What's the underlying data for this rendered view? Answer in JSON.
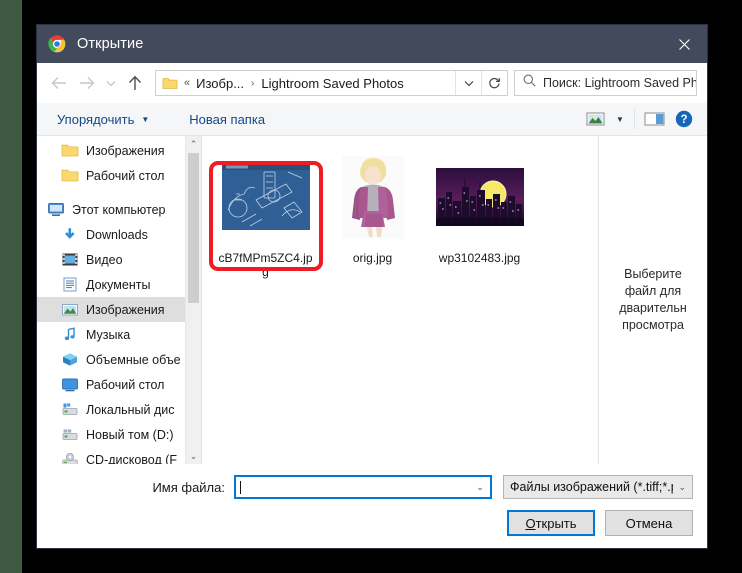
{
  "window": {
    "title": "Открытие",
    "app_icon": "chrome-icon",
    "close_label": "✕"
  },
  "nav": {
    "back_icon": "arrow-left-icon",
    "forward_icon": "arrow-right-icon",
    "recent_icon": "chevron-down-icon",
    "up_icon": "arrow-up-icon",
    "breadcrumb": {
      "folder_icon": "folder-icon",
      "overflow": "«",
      "items": [
        "Изобр...",
        "Lightroom Saved Photos"
      ],
      "separator": "›"
    },
    "dropdown_icon": "chevron-down-icon",
    "refresh_icon": "refresh-icon",
    "search": {
      "icon": "search-icon",
      "placeholder": "Поиск: Lightroom Saved Ph..."
    }
  },
  "toolbar": {
    "organize_label": "Упорядочить",
    "organize_caret": "▼",
    "new_folder_label": "Новая папка",
    "view_icon": "view-layout-icon",
    "view_caret": "▼",
    "preview_pane_icon": "preview-pane-icon",
    "help_icon": "help-icon"
  },
  "sidebar": {
    "scroll_up": "⌃",
    "scroll_down": "⌄",
    "items": [
      {
        "label": "Изображения",
        "icon": "folder-icon",
        "level": 2,
        "selected": false
      },
      {
        "label": "Рабочий стол",
        "icon": "folder-icon",
        "level": 2,
        "selected": false
      },
      {
        "label": "Этот компьютер",
        "icon": "computer-icon",
        "level": 1,
        "selected": false
      },
      {
        "label": "Downloads",
        "icon": "downloads-icon",
        "level": 2,
        "selected": false
      },
      {
        "label": "Видео",
        "icon": "video-icon",
        "level": 2,
        "selected": false
      },
      {
        "label": "Документы",
        "icon": "documents-icon",
        "level": 2,
        "selected": false
      },
      {
        "label": "Изображения",
        "icon": "pictures-icon",
        "level": 2,
        "selected": true
      },
      {
        "label": "Музыка",
        "icon": "music-icon",
        "level": 2,
        "selected": false
      },
      {
        "label": "Объемные объе",
        "icon": "3d-objects-icon",
        "level": 2,
        "selected": false
      },
      {
        "label": "Рабочий стол",
        "icon": "desktop-icon",
        "level": 2,
        "selected": false
      },
      {
        "label": "Локальный дис",
        "icon": "drive-icon",
        "level": 2,
        "selected": false
      },
      {
        "label": "Новый том (D:)",
        "icon": "drive-icon",
        "level": 2,
        "selected": false
      },
      {
        "label": "CD-дисковод (F",
        "icon": "cd-drive-icon",
        "level": 2,
        "selected": false
      }
    ]
  },
  "files": [
    {
      "name": "cB7fMPm5ZC4.jpg",
      "thumb": "blueprint-thumb",
      "highlighted": true
    },
    {
      "name": "orig.jpg",
      "thumb": "portrait-thumb",
      "highlighted": false
    },
    {
      "name": "wp3102483.jpg",
      "thumb": "cityscape-thumb",
      "highlighted": false
    }
  ],
  "preview": {
    "lines": [
      "Выберите",
      "файл для",
      "дварительн",
      "просмотра"
    ]
  },
  "footer": {
    "filename_label": "Имя файла:",
    "filename_value": "",
    "filename_caret": "⌄",
    "filter_value": "Файлы изображений (*.tiff;*.p",
    "filter_caret": "⌄",
    "open_accel": "О",
    "open_rest": "ткрыть",
    "cancel_label": "Отмена"
  },
  "colors": {
    "titlebar": "#434a5c",
    "accent": "#0078d7",
    "annotation": "#ee1d23",
    "link": "#16478a"
  }
}
